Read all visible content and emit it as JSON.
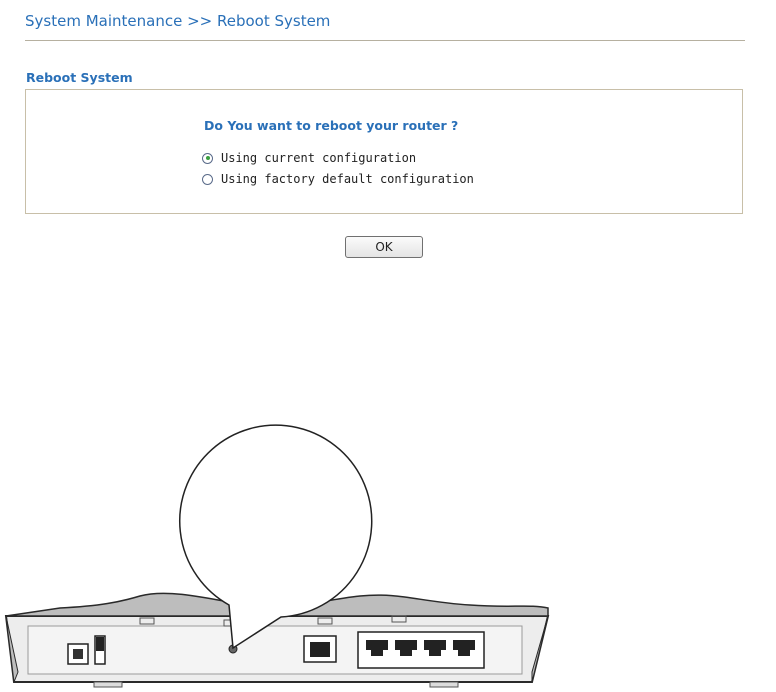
{
  "header": {
    "title": "System Maintenance >> Reboot System"
  },
  "section": {
    "title": "Reboot System",
    "question": "Do You want to reboot your router ?",
    "options": [
      {
        "label": "Using current configuration",
        "checked": true
      },
      {
        "label": "Using factory default configuration",
        "checked": false
      }
    ]
  },
  "actions": {
    "ok_label": "OK"
  },
  "colors": {
    "accent": "#2a70b8",
    "border": "#c8bfa8",
    "radio_dot": "#3aa040"
  },
  "illustration": {
    "subject": "router rear panel with callout balloon",
    "icons": [
      "power-jack-icon",
      "power-switch-icon",
      "reset-button-icon",
      "rj11-port-icon",
      "lan-port-icon"
    ]
  }
}
